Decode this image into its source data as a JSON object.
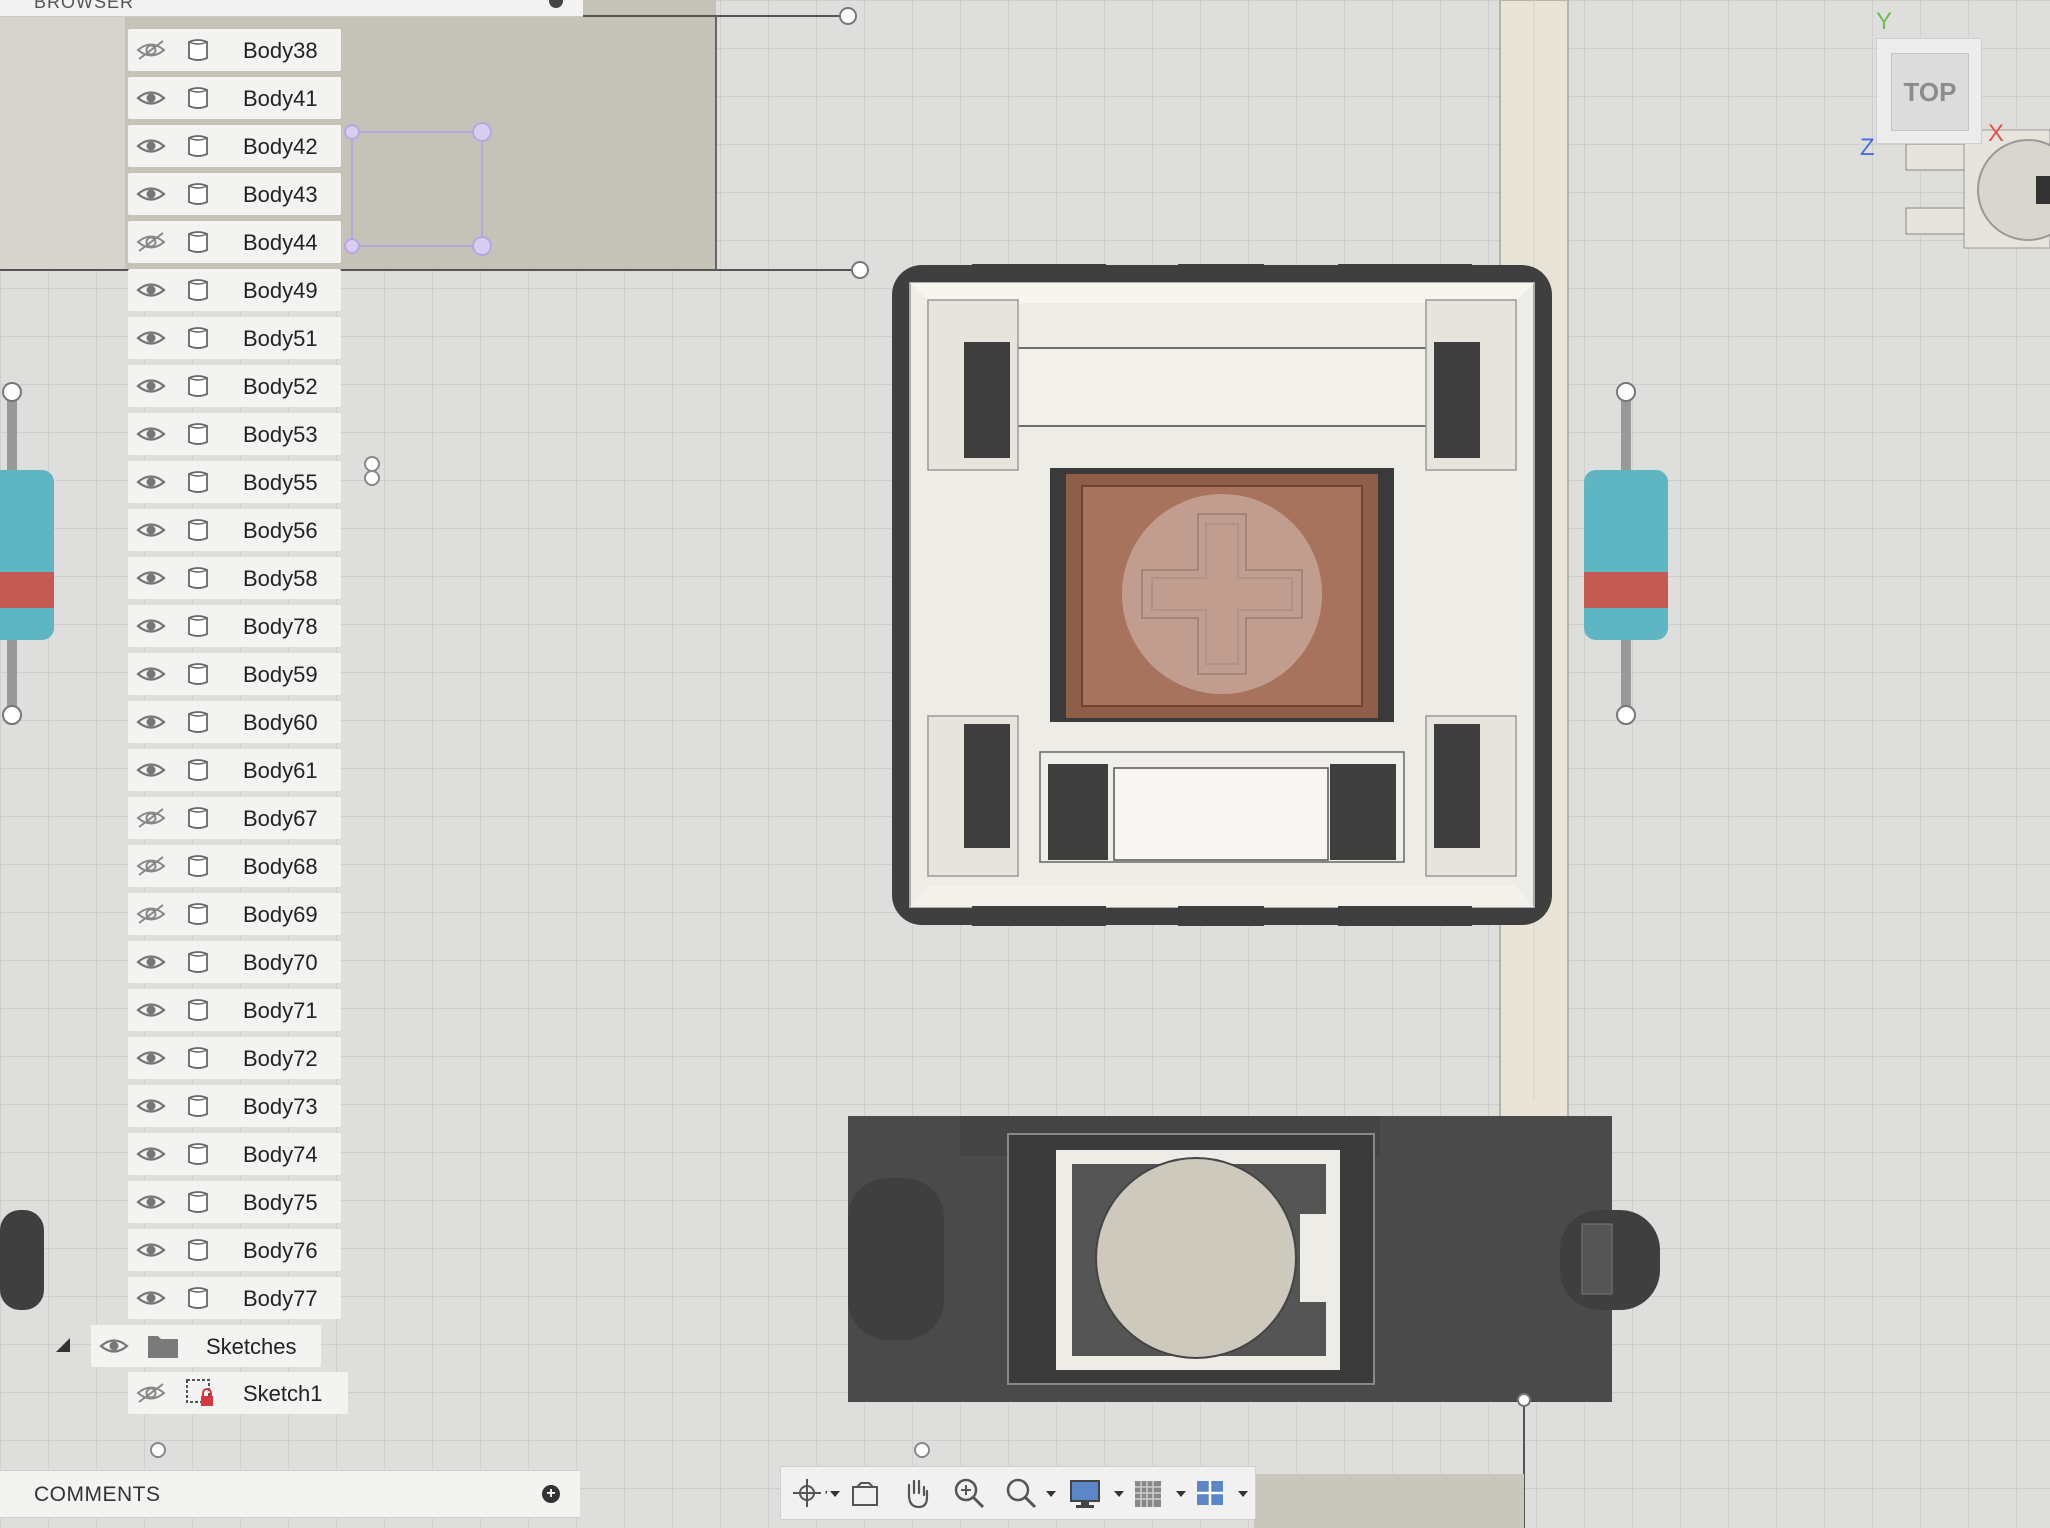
{
  "browser": {
    "title": "BROWSER",
    "bodies": [
      {
        "label": "Body38",
        "visible": false
      },
      {
        "label": "Body41",
        "visible": true
      },
      {
        "label": "Body42",
        "visible": true
      },
      {
        "label": "Body43",
        "visible": true
      },
      {
        "label": "Body44",
        "visible": false
      },
      {
        "label": "Body49",
        "visible": true
      },
      {
        "label": "Body51",
        "visible": true
      },
      {
        "label": "Body52",
        "visible": true
      },
      {
        "label": "Body53",
        "visible": true
      },
      {
        "label": "Body55",
        "visible": true
      },
      {
        "label": "Body56",
        "visible": true
      },
      {
        "label": "Body58",
        "visible": true
      },
      {
        "label": "Body78",
        "visible": true
      },
      {
        "label": "Body59",
        "visible": true
      },
      {
        "label": "Body60",
        "visible": true
      },
      {
        "label": "Body61",
        "visible": true
      },
      {
        "label": "Body67",
        "visible": false
      },
      {
        "label": "Body68",
        "visible": false
      },
      {
        "label": "Body69",
        "visible": false
      },
      {
        "label": "Body70",
        "visible": true
      },
      {
        "label": "Body71",
        "visible": true
      },
      {
        "label": "Body72",
        "visible": true
      },
      {
        "label": "Body73",
        "visible": true
      },
      {
        "label": "Body74",
        "visible": true
      },
      {
        "label": "Body75",
        "visible": true
      },
      {
        "label": "Body76",
        "visible": true
      },
      {
        "label": "Body77",
        "visible": true
      }
    ],
    "sketches_folder": {
      "label": "Sketches",
      "visible": true,
      "expanded": true
    },
    "sketches": [
      {
        "label": "Sketch1",
        "visible": false,
        "locked": true
      }
    ]
  },
  "comments": {
    "label": "COMMENTS",
    "add_icon": "plus-circle-icon"
  },
  "viewcube": {
    "face_label": "TOP",
    "axes": {
      "y": "Y",
      "x": "X",
      "z": "Z"
    },
    "axis_colors": {
      "y": "#6cc04a",
      "x": "#e0554a",
      "z": "#4a6ed8"
    }
  },
  "nav_toolbar": {
    "tools": [
      {
        "name": "orbit-icon",
        "has_menu": true
      },
      {
        "name": "look-at-icon",
        "has_menu": false
      },
      {
        "name": "pan-icon",
        "has_menu": false
      },
      {
        "name": "zoom-icon",
        "has_menu": false
      },
      {
        "name": "fit-icon",
        "has_menu": true
      },
      {
        "name": "display-settings-icon",
        "has_menu": true
      },
      {
        "name": "grid-settings-icon",
        "has_menu": true
      },
      {
        "name": "viewports-icon",
        "has_menu": true
      }
    ]
  },
  "colors": {
    "canvas": "#dededc",
    "switch_housing": "#eeece6",
    "stem": "#9a6a55",
    "dark_part": "#4a4a4a",
    "pipe": "#e8e4d8",
    "capacitor_blue": "#5fb6c3",
    "capacitor_red": "#c55a55"
  }
}
